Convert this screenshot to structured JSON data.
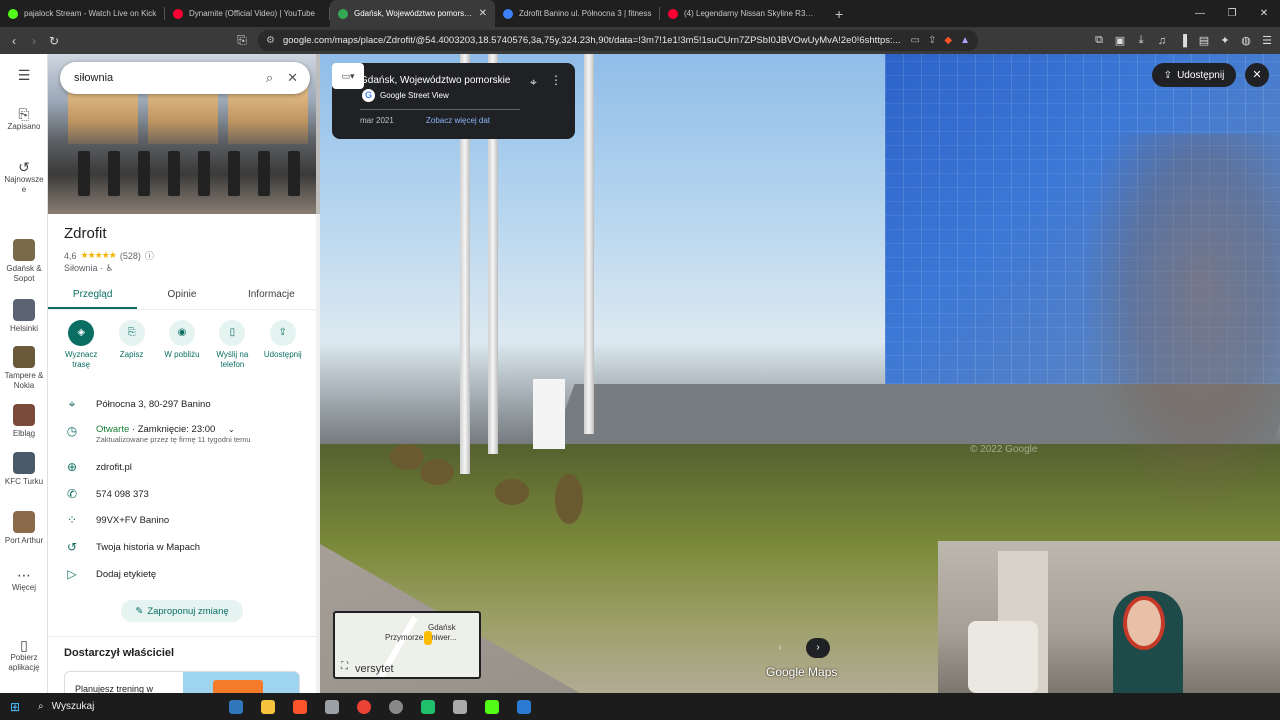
{
  "browser": {
    "tabs": [
      {
        "title": "pajalock Stream - Watch Live on Kick",
        "color": "#53fc18",
        "active": false
      },
      {
        "title": "Dynamite (Official Video) | YouTube",
        "color": "#ff0033",
        "active": false
      },
      {
        "title": "Gdańsk, Województwo pomorskie",
        "color": "#34a853",
        "active": true
      },
      {
        "title": "Zdrofit Banino ul. Północna 3 | fitness",
        "color": "#3b82f6",
        "active": false
      },
      {
        "title": "(4) Legendarny Nissan Skyline R34 na",
        "color": "#ff0033",
        "active": false
      }
    ],
    "url": "google.com/maps/place/Zdrofit/@54.4003203,18.5740576,3a,75y,324.23h,90t/data=!3m7!1e1!3m5!1suCUrn7ZPSbI0JBVOwUyMvA!2e0!6shttps:..."
  },
  "rail": {
    "saved": "Zapisano",
    "recent": "Najnowsze",
    "recent_wrap": "e",
    "history_items": [
      {
        "label": "Gdańsk & Sopot",
        "color": "#7a6a4a"
      },
      {
        "label": "Helsinki",
        "color": "#5a6470"
      },
      {
        "label": "Tampere & Nokia",
        "color": "#6a5a3a"
      },
      {
        "label": "Elbląg",
        "color": "#7a4a3a"
      },
      {
        "label": "KFC Turku",
        "color": "#4a5a6a"
      },
      {
        "label": "Port Arthur",
        "color": "#8a6a4a"
      }
    ],
    "more": "Więcej",
    "get_app": "Pobierz aplikację"
  },
  "panel": {
    "search_value": "siłownia",
    "title": "Zdrofit",
    "rating": "4,6",
    "stars": "★★★★★",
    "reviews": "(528)",
    "category": "Siłownia",
    "tabs": [
      "Przegląd",
      "Opinie",
      "Informacje"
    ],
    "actions": [
      {
        "label": "Wyznacz trasę",
        "icon": "◈"
      },
      {
        "label": "Zapisz",
        "icon": "⎘"
      },
      {
        "label": "W pobliżu",
        "icon": "◉"
      },
      {
        "label": "Wyślij na telefon",
        "icon": "▯"
      },
      {
        "label": "Udostępnij",
        "icon": "⇪"
      }
    ],
    "address": "Północna 3, 80-297 Banino",
    "open_status": "Otwarte",
    "close_time": "· Zamknięcie: 23:00",
    "updated": "Zaktualizowane przez tę firmę 11 tygodni temu",
    "website": "zdrofit.pl",
    "phone": "574 098 373",
    "plus_code": "99VX+FV Banino",
    "history": "Twoja historia w Mapach",
    "label": "Dodaj etykietę",
    "suggest": "Zaproponuj zmianę",
    "owner_heading": "Dostarczył właściciel",
    "promo_text": "Planujesz trening w"
  },
  "streetview": {
    "location": "Gdańsk, Województwo pomorskie",
    "provider": "Google Street View",
    "date": "mar 2021",
    "more_dates": "Zobacz więcej dat",
    "share": "Udostępnij",
    "watermark": "© 2022 Google",
    "minimap_city": "Gdańsk",
    "minimap_district": "Przymorze Uniwer...",
    "minimap_uni": "versytet",
    "logo": "Google Maps"
  },
  "taskbar": {
    "search": "Wyszukaj",
    "apps": [
      "#3277bc",
      "#f5c33b",
      "#fb542b",
      "#9aa0a6",
      "#ea4335",
      "#888",
      "#1fbf6b",
      "#aaa",
      "#53fc18",
      "#2a7bd1"
    ]
  }
}
